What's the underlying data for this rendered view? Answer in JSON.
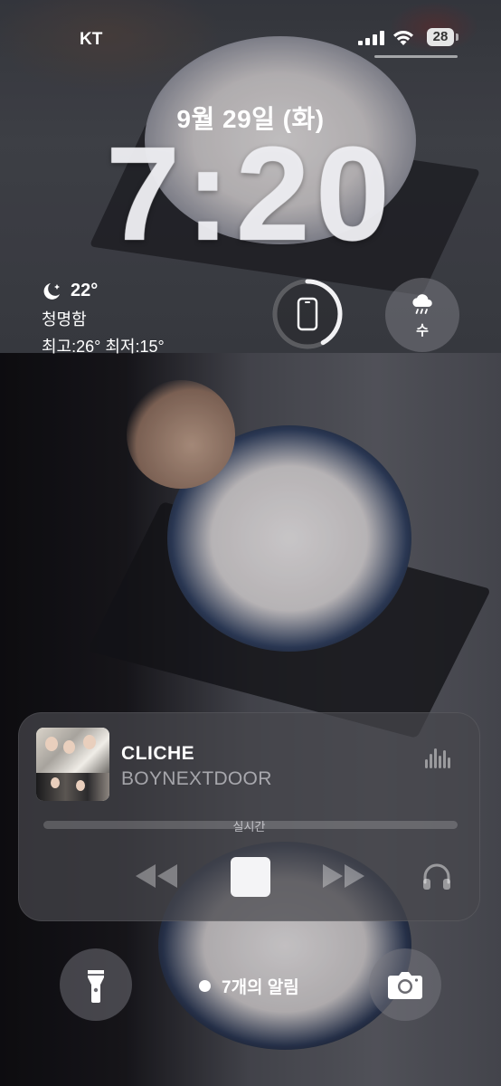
{
  "status_bar": {
    "carrier": "KT",
    "battery_level": "28"
  },
  "lock": {
    "date": "9월 29일 (화)",
    "time": "7:20"
  },
  "weather": {
    "temperature": "22°",
    "condition": "청명함",
    "high_low": "최고:26° 최저:15°",
    "icon": "moon-stars-icon"
  },
  "widgets": {
    "device_battery_fraction": 0.42,
    "device_icon": "iphone-icon",
    "rain_label": "수",
    "rain_icon": "cloud-rain-icon"
  },
  "now_playing": {
    "title": "CLICHE",
    "artist": "BOYNEXTDOOR",
    "live_label": "실시간",
    "controls": [
      "rewind-icon",
      "stop-icon",
      "fast-forward-icon",
      "airpods-icon"
    ]
  },
  "bottom": {
    "notification_text": "7개의 알림",
    "left_button": "flashlight-icon",
    "right_button": "camera-icon"
  }
}
